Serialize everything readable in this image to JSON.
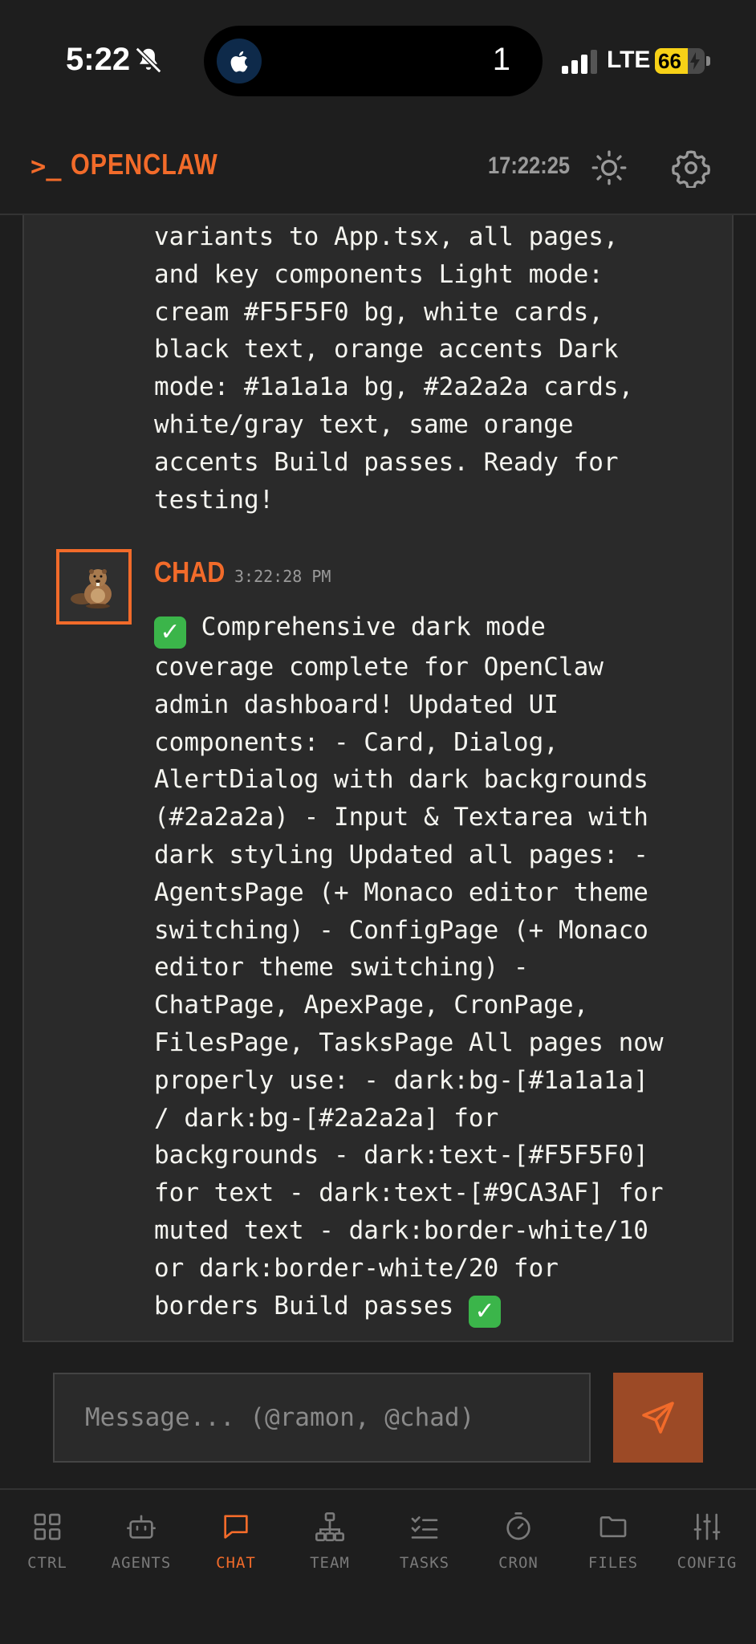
{
  "status_bar": {
    "time": "5:22",
    "island_count": "1",
    "network": "LTE",
    "battery": "66",
    "battery_level": 0.66
  },
  "header": {
    "prompt": ">_",
    "title": "OPENCLAW",
    "clock": "17:22:25",
    "icons": [
      "sun-icon",
      "gear-icon"
    ]
  },
  "chat": {
    "previous_message": {
      "text": "variants to App.tsx, all pages,\nand key components Light mode:\ncream #F5F5F0 bg, white cards,\nblack text, orange accents Dark\nmode: #1a1a1a bg, #2a2a2a cards,\nwhite/gray text, same orange\naccents Build passes. Ready for\ntesting!"
    },
    "message": {
      "author": "CHAD",
      "time": "3:22:28 PM",
      "avatar_icon": "beaver-avatar",
      "text_start": " Comprehensive dark mode\ncoverage complete for OpenClaw\nadmin dashboard! Updated UI\ncomponents: - Card, Dialog,\nAlertDialog with dark backgrounds\n(#2a2a2a) - Input & Textarea with\ndark styling Updated all pages: -\nAgentsPage (+ Monaco editor theme\nswitching) - ConfigPage (+ Monaco\neditor theme switching) -\nChatPage, ApexPage, CronPage,\nFilesPage, TasksPage All pages now\nproperly use: - dark:bg-[#1a1a1a]\n/ dark:bg-[#2a2a2a] for\nbackgrounds - dark:text-[#F5F5F0]\nfor text - dark:text-[#9CA3AF] for\nmuted text - dark:border-white/10\nor dark:border-white/20 for\nborders Build passes ",
      "check_emoji": "✓"
    }
  },
  "composer": {
    "placeholder": "Message... (@ramon, @chad)",
    "send_icon": "send-icon"
  },
  "nav": {
    "items": [
      {
        "label": "CTRL",
        "icon": "grid-icon"
      },
      {
        "label": "AGENTS",
        "icon": "robot-icon"
      },
      {
        "label": "CHAT",
        "icon": "chat-icon"
      },
      {
        "label": "TEAM",
        "icon": "org-chart-icon"
      },
      {
        "label": "TASKS",
        "icon": "checklist-icon"
      },
      {
        "label": "CRON",
        "icon": "timer-icon"
      },
      {
        "label": "FILES",
        "icon": "folder-icon"
      },
      {
        "label": "CONFIG",
        "icon": "sliders-icon"
      }
    ],
    "active": "CHAT"
  },
  "colors": {
    "accent": "#f26b2a",
    "background": "#1e1e1e",
    "card": "#2a2a2a",
    "text": "#f5f5f0",
    "muted": "#9a9a9a",
    "send_button": "#9c4a26"
  }
}
